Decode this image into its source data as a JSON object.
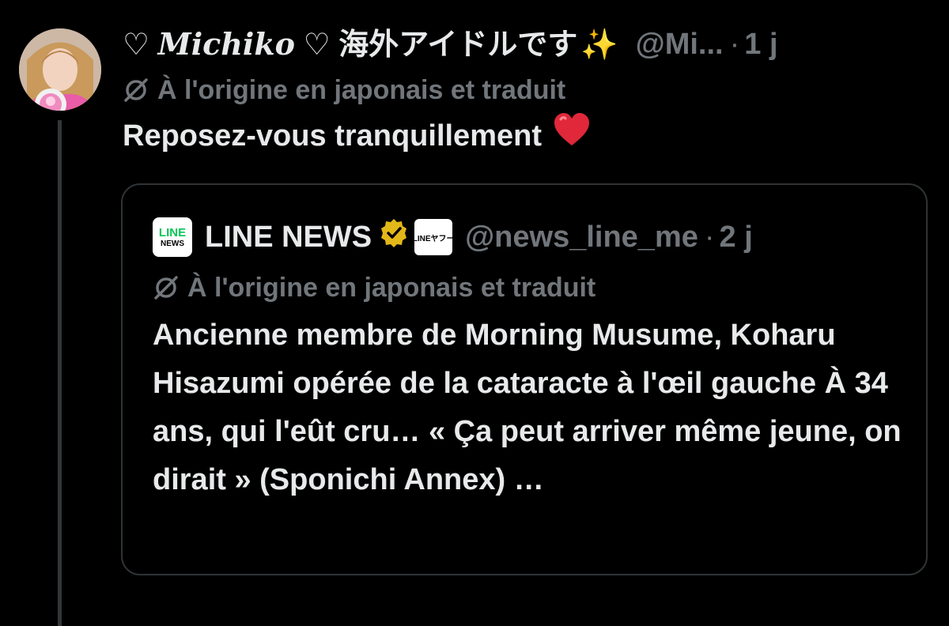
{
  "post": {
    "display_name": {
      "heart_left": "♡",
      "script_name": "𝑴𝒊𝒄𝒉𝒊𝒌𝒐",
      "heart_right": "♡",
      "japanese": "海外アイドルです",
      "sparkles": "✨"
    },
    "handle": "@Mi...",
    "separator": "·",
    "time": "1 j",
    "translation_note": "À l'origine en japonais et traduit",
    "text": "Reposez-vous tranquillement",
    "emoji": "❤️"
  },
  "quote": {
    "logo_text_top": "LINE",
    "logo_text_bottom": "NEWS",
    "name": "LINE NEWS",
    "verified": "gold-verified-badge",
    "affiliation_text": "LINEヤフー",
    "handle": "@news_line_me",
    "separator": "·",
    "time": "2 j",
    "translation_note": "À l'origine en japonais et traduit",
    "text": "Ancienne membre de Morning Musume, Koharu Hisazumi opérée de la cataracte à l'œil gauche À 34 ans, qui l'eût cru… « Ça peut arriver même jeune, on dirait » (Sponichi Annex)  …"
  },
  "colors": {
    "background": "#000000",
    "primary_text": "#e7e9ea",
    "secondary_text": "#71767b",
    "border": "#2f3336",
    "verified_gold": "#e2b719",
    "line_green": "#06c755"
  },
  "icons": [
    "avatar",
    "translation-icon",
    "line-news-logo",
    "gold-verified-badge",
    "line-yahoo-affiliate-icon"
  ]
}
